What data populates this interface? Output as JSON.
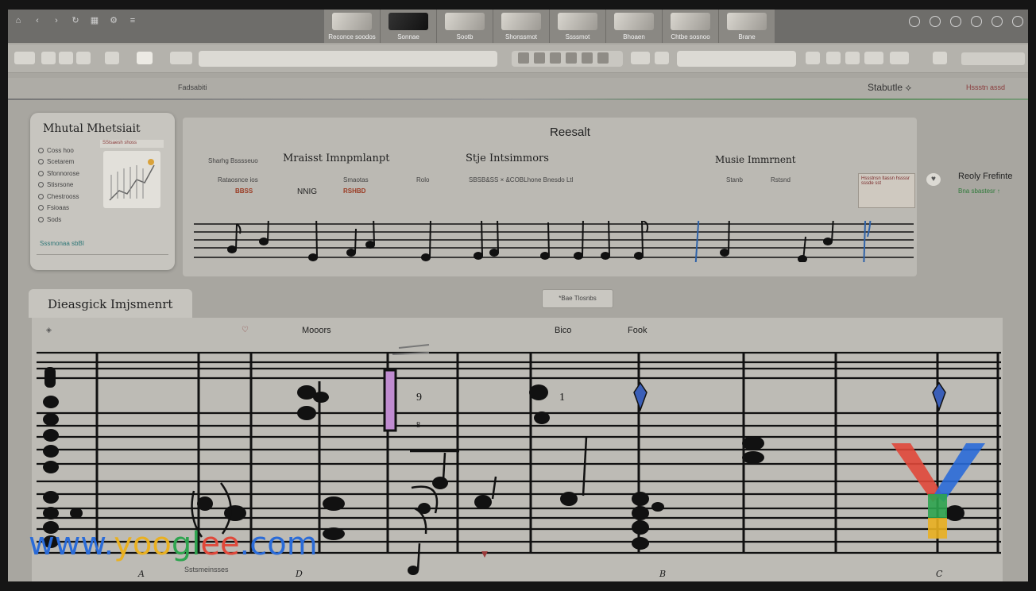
{
  "toolbar": {
    "address": "",
    "zoom": ""
  },
  "tabs": [
    {
      "label": "Reconce soodos"
    },
    {
      "label": "Sonnae"
    },
    {
      "label": "Sootb"
    },
    {
      "label": "Shonssmot"
    },
    {
      "label": "Ssssmot"
    },
    {
      "label": "Bhoaen"
    },
    {
      "label": "Chtbe sosnoo"
    },
    {
      "label": "Brane"
    }
  ],
  "subbar": {
    "crumb": "Fadsabiti",
    "state": "Stabutle  ⟡",
    "user": "Hssstn assd"
  },
  "left_panel": {
    "title": "Mhutal Mhetsiait",
    "items": [
      "Coss hoo",
      "Scetarem",
      "Sfonnorose",
      "Stisrsone",
      "Chestrooss",
      "Fsioaas",
      "Sods"
    ],
    "thumb_caption": "SStsaesh shoss",
    "footer": "Sssmonaa sbBI"
  },
  "result_panel": {
    "title": "Reesalt",
    "heading1": "Mraisst Imnpmlanpt",
    "heading2": "Stje Intsimmors",
    "heading3": "Musie Immrnent",
    "label_left": "Sharhg Bsssseuo",
    "sub1": "Rataosnce ios",
    "sub1_value": "BBSS",
    "sub2": "Smaotas",
    "sub2_value": "RSHBD",
    "sub3": "NNIG",
    "sub4": "Rolo",
    "sub5": "SBSB&SS  ×  &COBLhone  Bnesdo  Ltl",
    "sub6": "Stanb",
    "sub7": "Rstsnd",
    "side_note": "Hssstnsn ltassn hssssr sssde sst"
  },
  "right_side": {
    "title": "Reoly Frefinte",
    "sub": "Bna sbastesr  ↑"
  },
  "lower": {
    "tab": "Dieasgick Imjsmenrt",
    "button": "*Bae Tlosnbs",
    "col1": "Mooors",
    "col2": "Bico",
    "col3": "Fook",
    "bottom_label": "Sstsmeinsses",
    "bottom_letters": [
      "A",
      "D",
      "B",
      "C"
    ]
  },
  "watermark": {
    "parts": [
      "www.",
      "yoo",
      "gl",
      "ee",
      ".com"
    ]
  }
}
